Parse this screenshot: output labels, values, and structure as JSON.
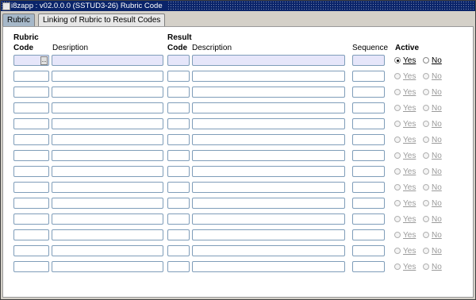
{
  "window": {
    "title": "i8zapp : v02.0.0.0 (SSTUD3-26) Rubric Code"
  },
  "tabs": [
    {
      "label": "Rubric",
      "active": true
    },
    {
      "label": "Linking of Rubric to Result Codes",
      "active": false
    }
  ],
  "headers": {
    "rubric": "Rubric",
    "code": "Code",
    "description": "Desription",
    "result": "Result",
    "result_code": "Code",
    "result_description": "Description",
    "sequence": "Sequence",
    "active": "Active"
  },
  "lookup_label": "...",
  "radio": {
    "yes_label": "Yes",
    "no_label": "No"
  },
  "rows": [
    {
      "rubric_code": "",
      "description": "",
      "result_code": "",
      "result_description": "",
      "sequence": "",
      "active": "Yes",
      "enabled": true
    },
    {
      "rubric_code": "",
      "description": "",
      "result_code": "",
      "result_description": "",
      "sequence": "",
      "active": "",
      "enabled": false
    },
    {
      "rubric_code": "",
      "description": "",
      "result_code": "",
      "result_description": "",
      "sequence": "",
      "active": "",
      "enabled": false
    },
    {
      "rubric_code": "",
      "description": "",
      "result_code": "",
      "result_description": "",
      "sequence": "",
      "active": "",
      "enabled": false
    },
    {
      "rubric_code": "",
      "description": "",
      "result_code": "",
      "result_description": "",
      "sequence": "",
      "active": "",
      "enabled": false
    },
    {
      "rubric_code": "",
      "description": "",
      "result_code": "",
      "result_description": "",
      "sequence": "",
      "active": "",
      "enabled": false
    },
    {
      "rubric_code": "",
      "description": "",
      "result_code": "",
      "result_description": "",
      "sequence": "",
      "active": "",
      "enabled": false
    },
    {
      "rubric_code": "",
      "description": "",
      "result_code": "",
      "result_description": "",
      "sequence": "",
      "active": "",
      "enabled": false
    },
    {
      "rubric_code": "",
      "description": "",
      "result_code": "",
      "result_description": "",
      "sequence": "",
      "active": "",
      "enabled": false
    },
    {
      "rubric_code": "",
      "description": "",
      "result_code": "",
      "result_description": "",
      "sequence": "",
      "active": "",
      "enabled": false
    },
    {
      "rubric_code": "",
      "description": "",
      "result_code": "",
      "result_description": "",
      "sequence": "",
      "active": "",
      "enabled": false
    },
    {
      "rubric_code": "",
      "description": "",
      "result_code": "",
      "result_description": "",
      "sequence": "",
      "active": "",
      "enabled": false
    },
    {
      "rubric_code": "",
      "description": "",
      "result_code": "",
      "result_description": "",
      "sequence": "",
      "active": "",
      "enabled": false
    },
    {
      "rubric_code": "",
      "description": "",
      "result_code": "",
      "result_description": "",
      "sequence": "",
      "active": "",
      "enabled": false
    }
  ]
}
